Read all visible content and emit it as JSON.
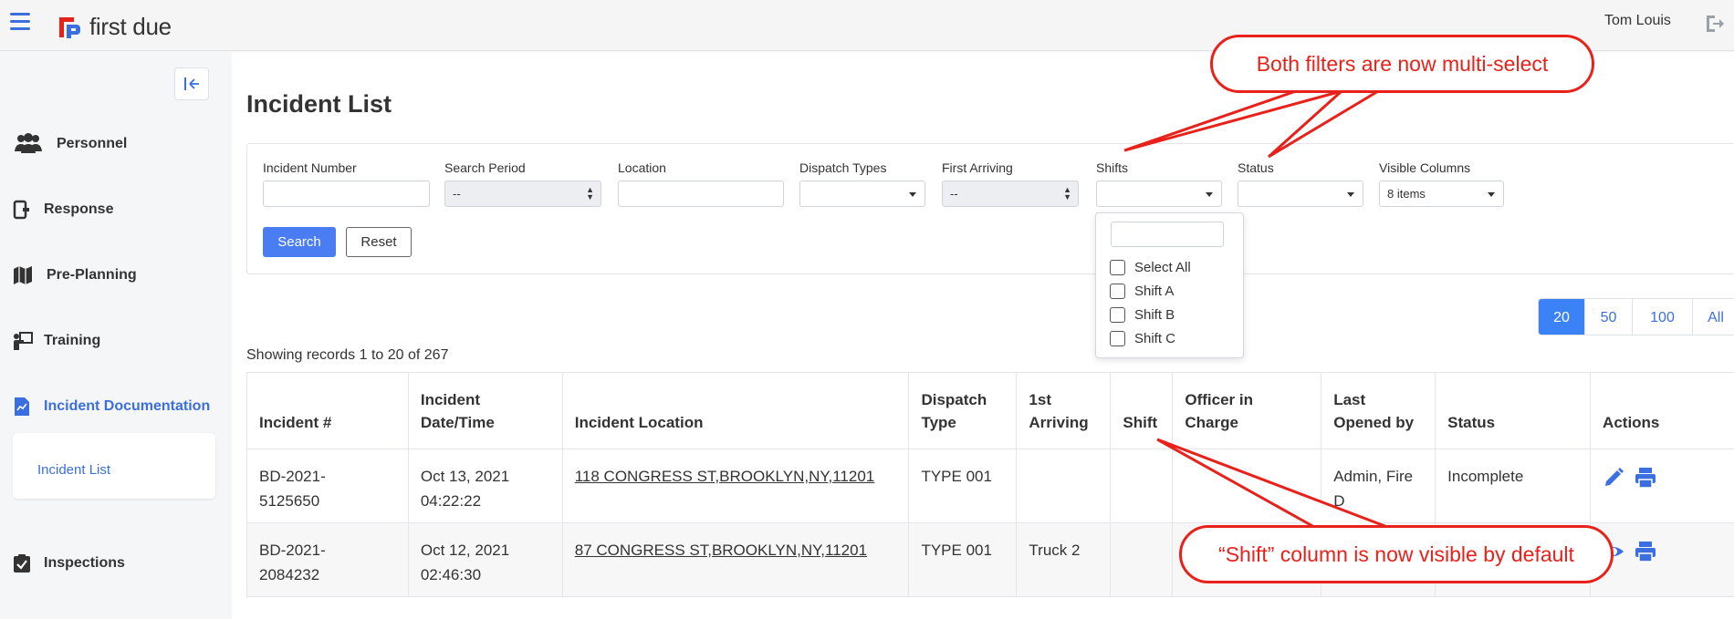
{
  "header": {
    "brand": "first due",
    "user_name": "Tom Louis"
  },
  "sidebar": {
    "items": [
      {
        "label": "Personnel",
        "icon": "people-icon"
      },
      {
        "label": "Response",
        "icon": "response-icon"
      },
      {
        "label": "Pre-Planning",
        "icon": "map-icon"
      },
      {
        "label": "Training",
        "icon": "training-icon"
      },
      {
        "label": "Incident Documentation",
        "icon": "document-icon"
      },
      {
        "label": "Inspections",
        "icon": "clipboard-check-icon"
      }
    ],
    "subitem": "Incident List"
  },
  "page": {
    "title": "Incident List"
  },
  "filters": {
    "incident_number": {
      "label": "Incident Number",
      "value": ""
    },
    "search_period": {
      "label": "Search Period",
      "value": "--"
    },
    "location": {
      "label": "Location",
      "value": ""
    },
    "dispatch_types": {
      "label": "Dispatch Types",
      "value": ""
    },
    "first_arriving": {
      "label": "First Arriving",
      "value": "--"
    },
    "shifts": {
      "label": "Shifts",
      "value": ""
    },
    "status": {
      "label": "Status",
      "value": ""
    },
    "visible_columns": {
      "label": "Visible Columns",
      "value": "8 items"
    },
    "search_label": "Search",
    "reset_label": "Reset"
  },
  "shifts_dropdown": {
    "search_value": "",
    "options": [
      "Select All",
      "Shift A",
      "Shift B",
      "Shift C"
    ]
  },
  "pager": {
    "sizes": [
      "20",
      "50",
      "100",
      "All"
    ],
    "active": "20"
  },
  "records_text": "Showing records 1 to 20 of 267",
  "table": {
    "headers": [
      {
        "l1": "",
        "l2": "Incident #"
      },
      {
        "l1": "Incident",
        "l2": "Date/Time"
      },
      {
        "l1": "",
        "l2": "Incident Location"
      },
      {
        "l1": "Dispatch",
        "l2": "Type"
      },
      {
        "l1": "1st",
        "l2": "Arriving"
      },
      {
        "l1": "",
        "l2": "Shift"
      },
      {
        "l1": "Officer in",
        "l2": "Charge"
      },
      {
        "l1": "Last",
        "l2": "Opened by"
      },
      {
        "l1": "",
        "l2": "Status"
      },
      {
        "l1": "",
        "l2": "Actions"
      }
    ],
    "rows": [
      {
        "num1": "BD-2021-",
        "num2": "5125650",
        "date1": "Oct 13, 2021",
        "date2": "04:22:22",
        "location": "118 CONGRESS ST,BROOKLYN,NY,11201",
        "type": "TYPE 001",
        "arriving": "",
        "shift": "",
        "officer": "",
        "opened1": "Admin, Fire",
        "opened2": "D",
        "status": "Incomplete"
      },
      {
        "num1": "BD-2021-",
        "num2": "2084232",
        "date1": "Oct 12, 2021",
        "date2": "02:46:30",
        "location": "87 CONGRESS ST,BROOKLYN,NY,11201",
        "type": "TYPE 001",
        "arriving": "Truck 2",
        "shift": "",
        "officer": "",
        "opened1": "",
        "opened2": "",
        "status": ""
      }
    ]
  },
  "annotations": {
    "top": "Both filters are now multi-select",
    "bottom": "“Shift” column is now visible by default"
  },
  "colors": {
    "accent": "#3b6fe0",
    "primary_button": "#4a7df2",
    "annotation": "#e8211b"
  }
}
